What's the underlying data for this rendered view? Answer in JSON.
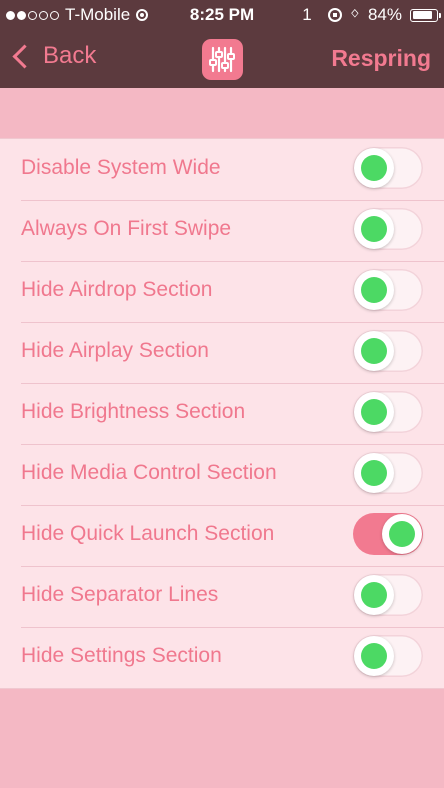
{
  "status_bar": {
    "carrier": "T-Mobile",
    "signal_dots_filled": 2,
    "signal_dots_total": 5,
    "time": "8:25 PM",
    "unread_count": "1",
    "battery_percent": "84%",
    "battery_level": 0.84,
    "icons": [
      "wifi-icon",
      "rotation-lock-icon",
      "bluetooth-icon",
      "battery-icon"
    ]
  },
  "nav": {
    "back_label": "Back",
    "action_label": "Respring",
    "logo_icon": "sliders-icon"
  },
  "colors": {
    "accent": "#f27a90",
    "header_bg": "#5c3a3e",
    "page_bg": "#f4b8c4",
    "list_bg": "#fde3e8",
    "knob_dot": "#4cd964"
  },
  "settings": [
    {
      "label": "Disable System Wide",
      "on": false
    },
    {
      "label": "Always On First Swipe",
      "on": false
    },
    {
      "label": "Hide Airdrop Section",
      "on": false
    },
    {
      "label": "Hide Airplay Section",
      "on": false
    },
    {
      "label": "Hide Brightness Section",
      "on": false
    },
    {
      "label": "Hide Media Control Section",
      "on": false
    },
    {
      "label": "Hide Quick Launch Section",
      "on": true
    },
    {
      "label": "Hide Separator Lines",
      "on": false
    },
    {
      "label": "Hide Settings Section",
      "on": false
    }
  ]
}
